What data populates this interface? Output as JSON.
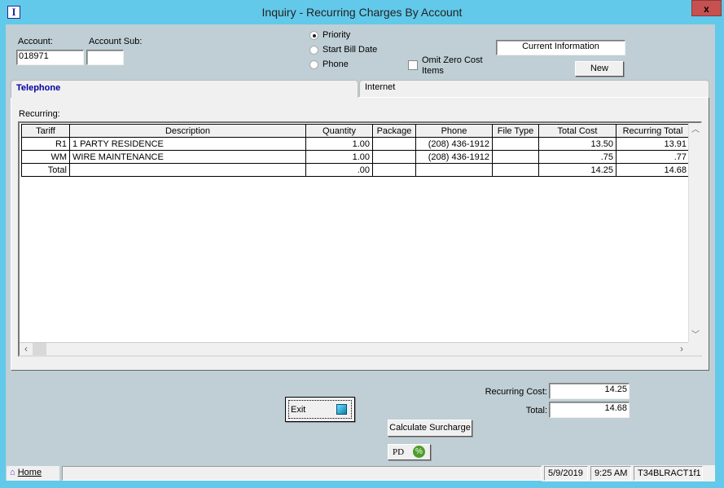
{
  "window": {
    "title": "Inquiry - Recurring Charges By Account",
    "app_icon": "I",
    "close": "x"
  },
  "form": {
    "account_label": "Account:",
    "account_value": "018971",
    "account_sub_label": "Account Sub:",
    "account_sub_value": "",
    "sort_options": [
      {
        "label": "Priority",
        "selected": true
      },
      {
        "label": "Start Bill Date",
        "selected": false
      },
      {
        "label": "Phone",
        "selected": false
      }
    ],
    "omit_zero_label_1": "Omit Zero Cost",
    "omit_zero_label_2": "Items",
    "omit_zero_checked": false,
    "current_info": "Current Information",
    "new_button": "New"
  },
  "tabs": [
    {
      "label": "Telephone",
      "active": true
    },
    {
      "label": "Internet",
      "active": false
    }
  ],
  "grid": {
    "section_label": "Recurring:",
    "columns": [
      "Tariff",
      "Description",
      "Quantity",
      "Package",
      "Phone",
      "File Type",
      "Total Cost",
      "Recurring Total"
    ],
    "rows": [
      [
        "R1",
        "1 PARTY RESIDENCE",
        "1.00",
        "",
        "(208) 436-1912",
        "",
        "13.50",
        "13.91"
      ],
      [
        "WM",
        "WIRE MAINTENANCE",
        "1.00",
        "",
        "(208) 436-1912",
        "",
        ".75",
        ".77"
      ],
      [
        "Total",
        "",
        ".00",
        "",
        "",
        "",
        "14.25",
        "14.68"
      ]
    ]
  },
  "totals": {
    "recurring_cost_label": "Recurring Cost:",
    "recurring_cost": "14.25",
    "total_label": "Total:",
    "total": "14.68"
  },
  "buttons": {
    "exit": "Exit",
    "calculate_surcharge": "Calculate Surcharge",
    "pd": "PD"
  },
  "status": {
    "home": "Home",
    "message": "",
    "date": "5/9/2019",
    "time": "9:25 AM",
    "code": "T34BLRACT1f1"
  },
  "colors": {
    "title_bar": "#62c9ea",
    "form_bg": "#bfcfd5",
    "close": "#c75050",
    "active_tab_text": "#0000a0"
  }
}
